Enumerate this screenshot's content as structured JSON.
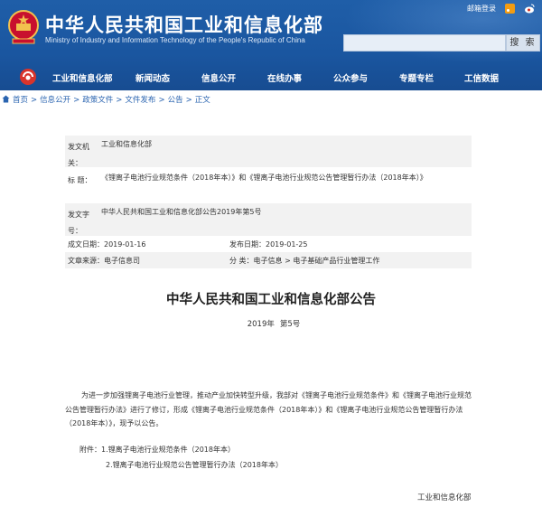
{
  "header": {
    "title": "中华人民共和国工业和信息化部",
    "subtitle": "Ministry of Industry and Information Technology of the People's Republic of China",
    "login_label": "邮箱登录",
    "search_button": "搜 索",
    "search_placeholder": ""
  },
  "nav": {
    "items": [
      "工业和信息化部",
      "新闻动态",
      "信息公开",
      "在线办事",
      "公众参与",
      "专题专栏",
      "工信数据"
    ]
  },
  "breadcrumb": {
    "items": [
      "首页",
      "信息公开",
      "政策文件",
      "文件发布",
      "公告",
      "正文"
    ],
    "separator": ">"
  },
  "meta": {
    "issuer_label": "发文机关：",
    "issuer": "工业和信息化部",
    "title_label": "标 题：",
    "title": "《锂离子电池行业规范条件（2018年本）》和《锂离子电池行业规范公告管理暂行办法（2018年本）》",
    "docno_label": "发文字号：",
    "docno": "中华人民共和国工业和信息化部公告2019年第5号",
    "created": "成文日期：2019-01-16",
    "published": "发布日期：2019-01-25",
    "source": "文章来源：电子信息司",
    "category": "分 类：电子信息 > 电子基础产品行业管理工作"
  },
  "document": {
    "heading": "中华人民共和国工业和信息化部公告",
    "year": "2019年",
    "number": "第5号",
    "body": "为进一步加强锂离子电池行业管理，推动产业加快转型升级，我部对《锂离子电池行业规范条件》和《锂离子电池行业规范公告管理暂行办法》进行了修订，形成《锂离子电池行业规范条件（2018年本）》和《锂离子电池行业规范公告管理暂行办法（2018年本）》，现予以公告。",
    "attachments_label": "附件：",
    "attachments": [
      "1.锂离子电池行业规范条件（2018年本）",
      "2.锂离子电池行业规范公告管理暂行办法（2018年本）"
    ],
    "signature": "工业和信息化部"
  },
  "colors": {
    "header_blue": "#1a56a0",
    "link_blue": "#2a64b0",
    "meta_bg": "#f2f2f2"
  },
  "icons": [
    "national-emblem-icon",
    "rss-icon",
    "weibo-icon",
    "nav-logo-icon",
    "home-icon"
  ]
}
